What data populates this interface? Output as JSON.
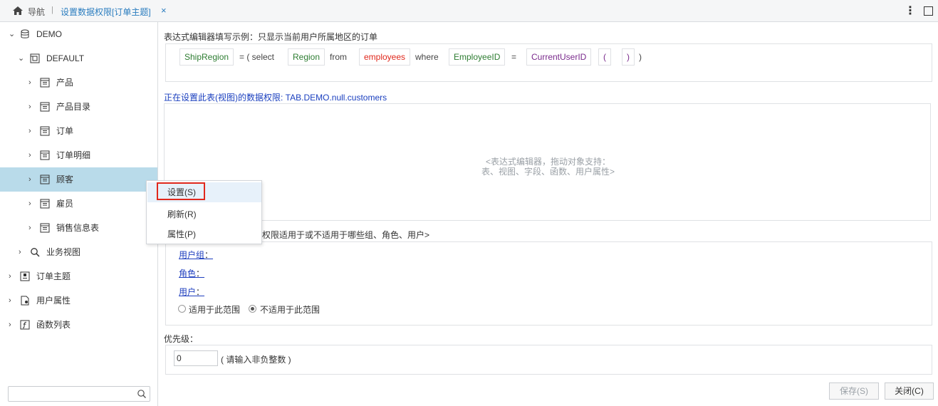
{
  "topbar": {
    "nav_label": "导航",
    "separator": "|",
    "tab_label": "设置数据权限[订单主题]",
    "tab_close": "×",
    "more": "⋮"
  },
  "tree": [
    {
      "label": "DEMO",
      "icon": "database-icon",
      "arrow": "⌄"
    },
    {
      "label": "DEFAULT",
      "icon": "schema-icon",
      "arrow": "⌄"
    },
    {
      "label": "产品",
      "icon": "table-icon",
      "arrow": "›"
    },
    {
      "label": "产品目录",
      "icon": "table-icon",
      "arrow": "›"
    },
    {
      "label": "订单",
      "icon": "table-icon",
      "arrow": "›"
    },
    {
      "label": "订单明细",
      "icon": "table-icon",
      "arrow": "›"
    },
    {
      "label": "顾客",
      "icon": "table-icon",
      "arrow": "›",
      "selected": true
    },
    {
      "label": "雇员",
      "icon": "table-icon",
      "arrow": "›"
    },
    {
      "label": "销售信息表",
      "icon": "table-icon",
      "arrow": "›"
    },
    {
      "label": "业务视图",
      "icon": "search-icon",
      "arrow": "›"
    },
    {
      "label": "订单主题",
      "icon": "topic-icon",
      "arrow": "›"
    },
    {
      "label": "用户属性",
      "icon": "user-attr-icon",
      "arrow": "›"
    },
    {
      "label": "函数列表",
      "icon": "function-icon",
      "arrow": "›"
    }
  ],
  "example": {
    "label": "表达式编辑器填写示例：只显示当前用户所属地区的订单",
    "tokens": {
      "t1": "ShipRegion",
      "t2": "= ( select",
      "t3": "Region",
      "t4": "from",
      "t5": "employees",
      "t6": "where",
      "t7": "EmployeeID",
      "t8": "=",
      "t9": "CurrentUserID",
      "t10": "(",
      "t11": ")",
      "t12": ")"
    }
  },
  "editor": {
    "label": "正在设置此表(视图)的数据权限: TAB.DEMO.null.customers",
    "hint_line1": "<表达式编辑器，拖动对象支持：",
    "hint_line2": "表、视图、字段、函数、用户属性>"
  },
  "scope": {
    "label": "权限适用于或不适用于哪些组、角色、用户>",
    "user_group": "用户组",
    "role": "角色",
    "user": "用户",
    "colon": "：",
    "radio_apply": "适用于此范围",
    "radio_not_apply": "不适用于此范围",
    "selected": "not_apply"
  },
  "priority": {
    "label": "优先级：",
    "value": "0",
    "hint": "( 请输入非负整数 )"
  },
  "buttons": {
    "save": "保存(S)",
    "close": "关闭(C)"
  },
  "context_menu": {
    "items": [
      "设置(S)",
      "刷新(R)",
      "属性(P)"
    ]
  },
  "colors": {
    "selected_row": "#b9dbea",
    "link": "#1f3fbf",
    "field_green": "#2e7d32",
    "table_red": "#e0281c",
    "attr_purple": "#7a2a8c",
    "highlight_border": "#e0281c"
  }
}
